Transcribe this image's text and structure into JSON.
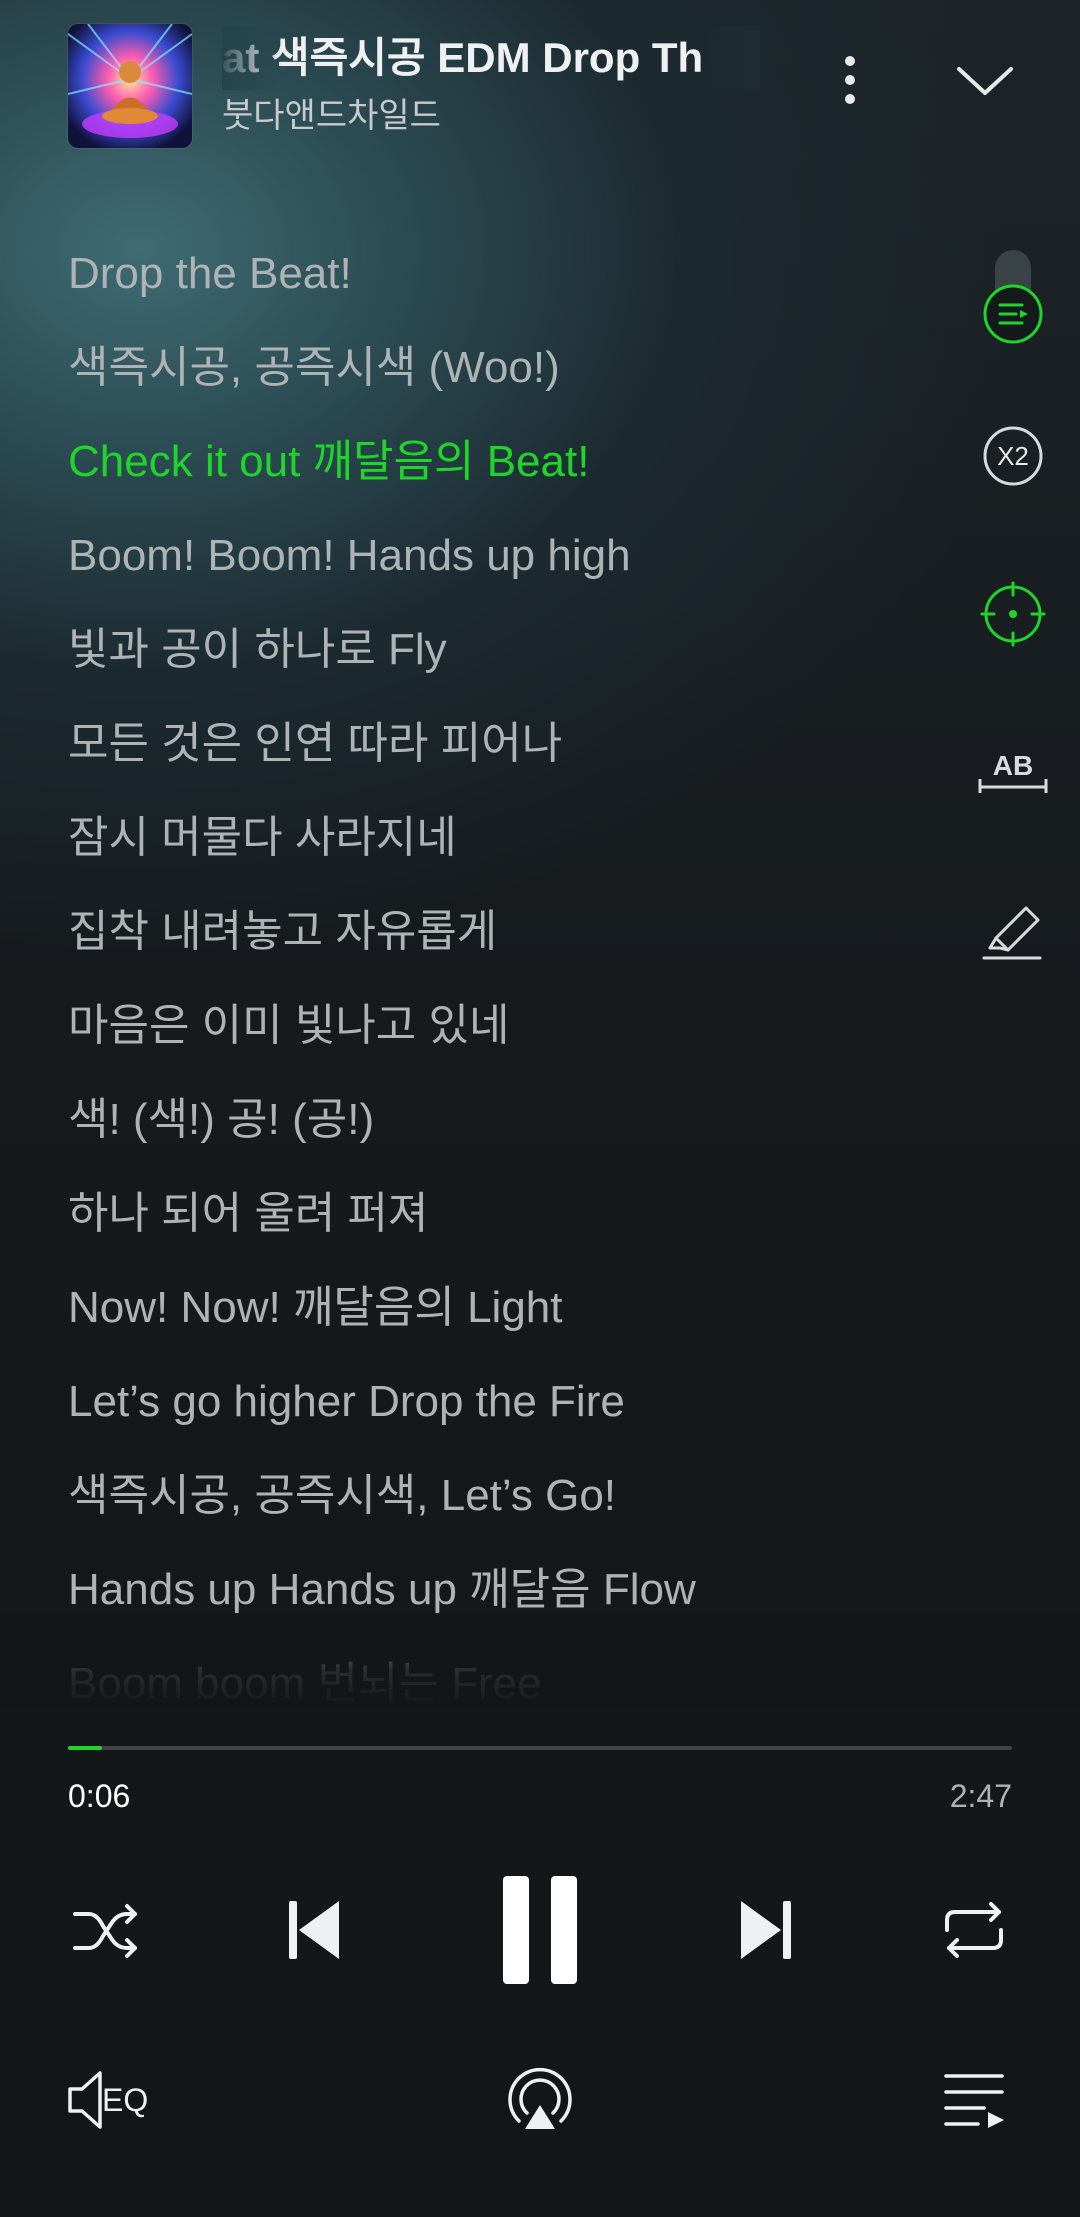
{
  "header": {
    "track_title": "at   색즉시공 EDM Drop Th",
    "artist": "붓다앤드차일드",
    "album_art_icon": "album-art-buddha",
    "more_icon": "more-vertical-icon",
    "collapse_icon": "chevron-down-icon"
  },
  "lyrics": {
    "lines": [
      "Drop the Beat!",
      "색즉시공, 공즉시색 (Woo!)",
      "Check it out 깨달음의 Beat!",
      "Boom! Boom! Hands up high",
      "빛과 공이 하나로 Fly",
      "모든 것은 인연 따라 피어나",
      "잠시 머물다 사라지네",
      "집착 내려놓고 자유롭게",
      "마음은 이미 빛나고 있네",
      "색! (색!) 공! (공!)",
      "하나 되어 울려 퍼져",
      "Now! Now! 깨달음의 Light",
      "Let’s go higher Drop the Fire",
      "색즉시공, 공즉시색, Let’s Go!",
      "Hands up Hands up 깨달음 Flow",
      "Boom boom 번뇌는 Free"
    ],
    "active_index": 2
  },
  "tools": {
    "speed_label": "X2",
    "ab_label": "AB",
    "colors": {
      "accent": "#1fd42a",
      "icon": "#d8dbdd"
    }
  },
  "progress": {
    "current": "0:06",
    "total": "2:47",
    "fraction": 0.036
  },
  "controls": {
    "shuffle_icon": "shuffle-icon",
    "prev_icon": "skip-previous-icon",
    "pause_icon": "pause-icon",
    "next_icon": "skip-next-icon",
    "repeat_icon": "repeat-icon"
  },
  "bottom": {
    "eq_label": "EQ",
    "cast_icon": "cast-icon",
    "playlist_icon": "playlist-icon"
  }
}
